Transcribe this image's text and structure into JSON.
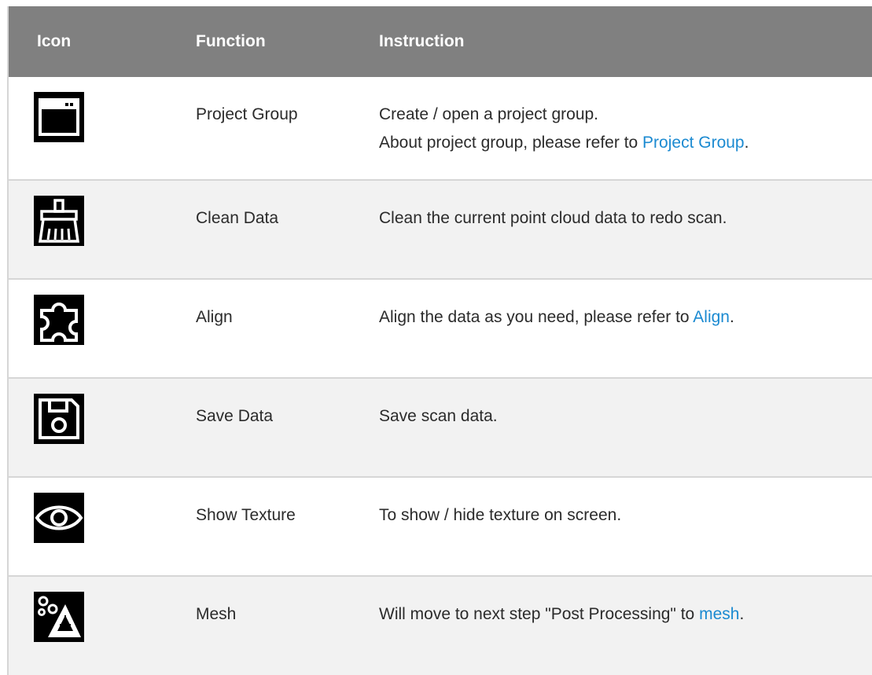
{
  "headers": {
    "icon": "Icon",
    "function": "Function",
    "instruction": "Instruction"
  },
  "rows": [
    {
      "icon": "window-icon",
      "function": "Project Group",
      "line1": "Create / open a project group.",
      "line2_pre": "About project group, please refer to ",
      "line2_link": "Project Group",
      "line2_post": "."
    },
    {
      "icon": "broom-icon",
      "function": "Clean Data",
      "text": "Clean the current point cloud data to redo scan."
    },
    {
      "icon": "puzzle-icon",
      "function": "Align",
      "pre": "Align the data as you need, please refer to ",
      "link": "Align",
      "post": "."
    },
    {
      "icon": "floppy-disk-icon",
      "function": "Save Data",
      "text": "Save scan data."
    },
    {
      "icon": "eye-icon",
      "function": "Show Texture",
      "text": "To show / hide texture on screen."
    },
    {
      "icon": "mesh-icon",
      "function": "Mesh",
      "pre": "Will move to next step \"Post Processing\" to ",
      "link": "mesh",
      "post": "."
    }
  ],
  "colors": {
    "header_bg": "#808080",
    "stripe_bg": "#f2f2f2",
    "link": "#1b8ad1",
    "border": "#d6d6d6"
  }
}
